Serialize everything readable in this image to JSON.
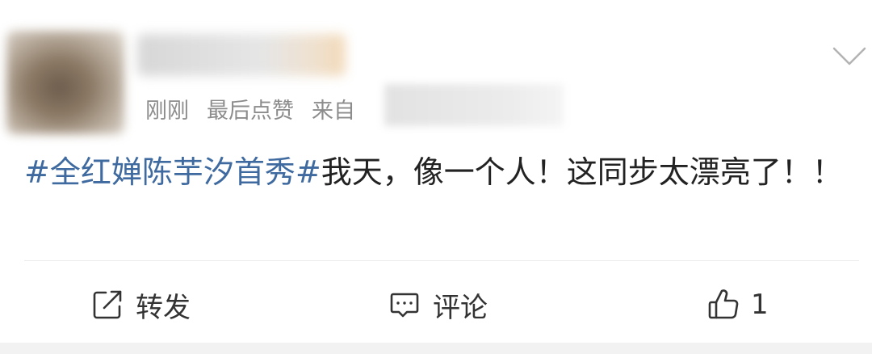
{
  "post": {
    "meta": {
      "time": "刚刚",
      "activity": "最后点赞",
      "source_prefix": "来自"
    },
    "topic": "#全红婵陈芋汐首秀#",
    "text": "我天，像一个人！这同步太漂亮了！！"
  },
  "actions": {
    "repost_label": "转发",
    "comment_label": "评论",
    "like_count": "1"
  },
  "icons": {
    "expand": "chevron-down-icon",
    "repost": "share-icon",
    "comment": "comment-icon",
    "like": "thumbs-up-icon"
  },
  "colors": {
    "topic_link": "#3e6aa0",
    "meta_text": "#8c8c8c",
    "body_text": "#222222",
    "icon": "#333333"
  }
}
